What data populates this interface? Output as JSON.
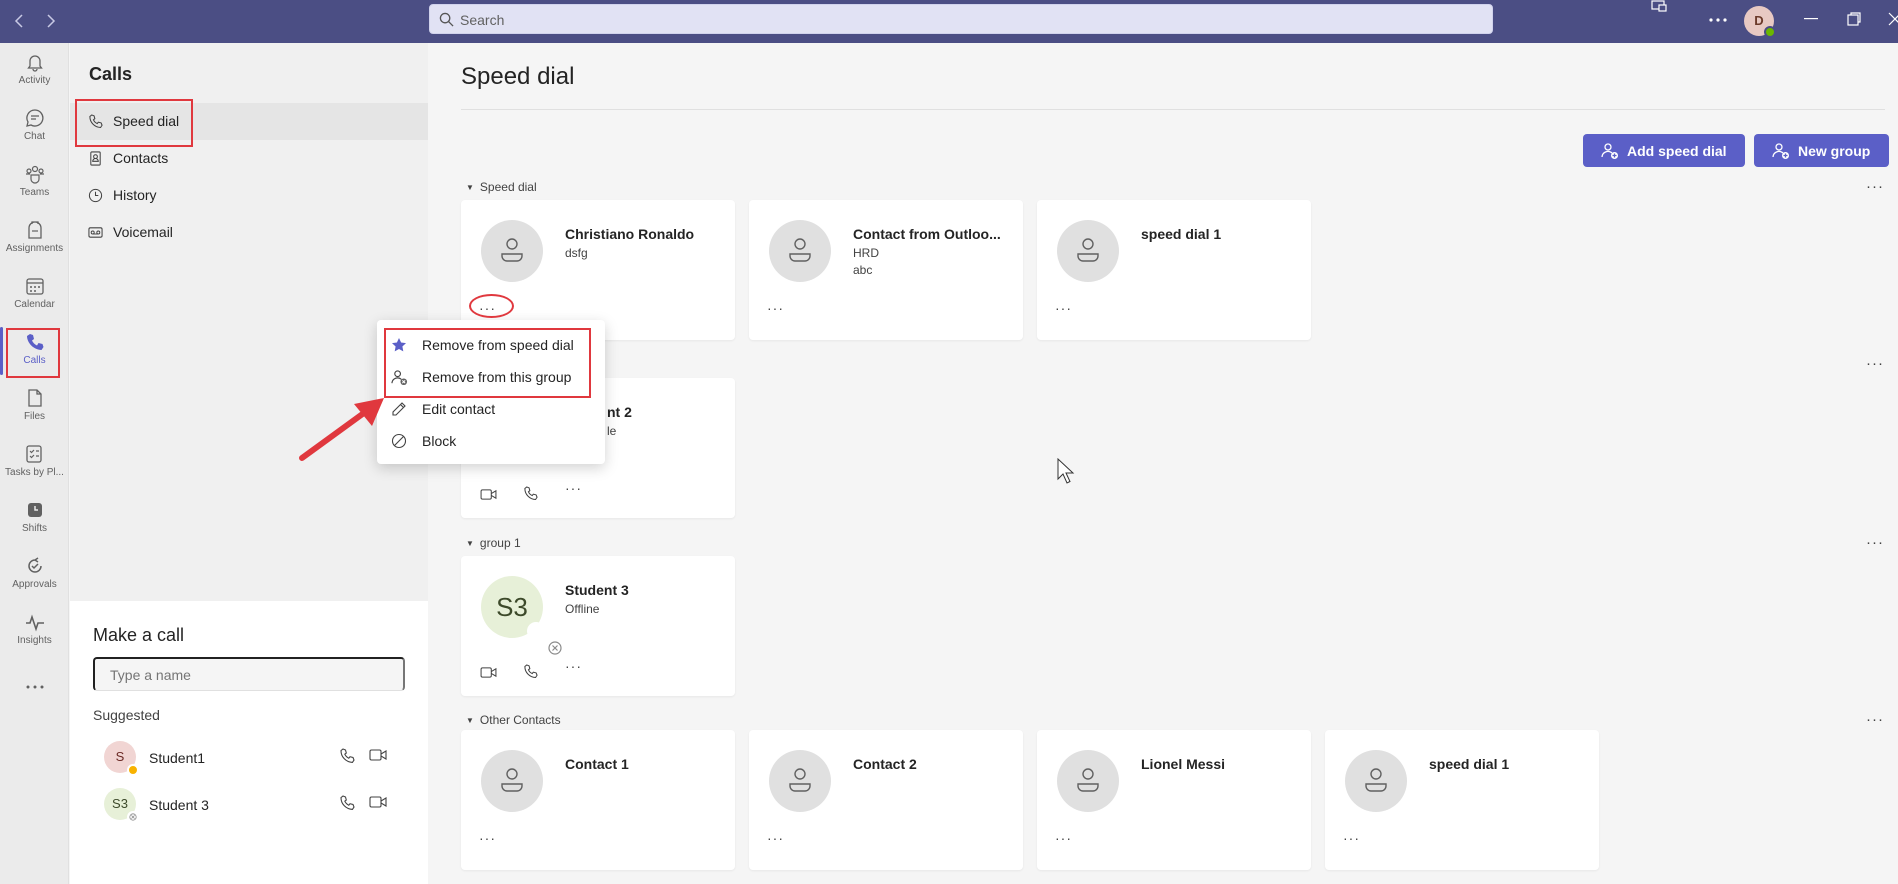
{
  "search": {
    "placeholder": "Search"
  },
  "user": {
    "initial": "D"
  },
  "rail": [
    {
      "label": "Activity",
      "icon": "bell-icon"
    },
    {
      "label": "Chat",
      "icon": "chat-icon"
    },
    {
      "label": "Teams",
      "icon": "teams-icon"
    },
    {
      "label": "Assignments",
      "icon": "assignments-icon"
    },
    {
      "label": "Calendar",
      "icon": "calendar-icon"
    },
    {
      "label": "Calls",
      "icon": "phone-icon"
    },
    {
      "label": "Files",
      "icon": "file-icon"
    },
    {
      "label": "Tasks by Pl...",
      "icon": "tasks-icon"
    },
    {
      "label": "Shifts",
      "icon": "shifts-icon"
    },
    {
      "label": "Approvals",
      "icon": "approvals-icon"
    },
    {
      "label": "Insights",
      "icon": "insights-icon"
    }
  ],
  "panel": {
    "title": "Calls",
    "nav": [
      {
        "label": "Speed dial",
        "icon": "phone-icon"
      },
      {
        "label": "Contacts",
        "icon": "contacts-icon"
      },
      {
        "label": "History",
        "icon": "clock-icon"
      },
      {
        "label": "Voicemail",
        "icon": "voicemail-icon"
      }
    ],
    "make_call": {
      "title": "Make a call",
      "placeholder": "Type a name",
      "suggested_label": "Suggested",
      "suggested": [
        {
          "initials": "S",
          "name": "Student1",
          "avatar_bg": "#f1d5d3",
          "presence": "#f8b200"
        },
        {
          "initials": "S3",
          "name": "Student 3",
          "avatar_bg": "#e7f0d8",
          "presence": "#ffffff"
        }
      ]
    }
  },
  "main": {
    "title": "Speed dial",
    "add_speed_dial": "Add speed dial",
    "new_group": "New group",
    "sections": [
      {
        "name": "Speed dial",
        "contacts": [
          {
            "name": "Christiano Ronaldo",
            "lines": [
              "dsfg"
            ]
          },
          {
            "name": "Contact from Outloo...",
            "lines": [
              "HRD",
              "abc"
            ]
          },
          {
            "name": "speed dial 1",
            "lines": []
          }
        ]
      },
      {
        "name": "",
        "contacts": [
          {
            "name": "nt 2",
            "lines": [
              "le"
            ]
          }
        ]
      },
      {
        "name": "group 1",
        "contacts": [
          {
            "name": "Student 3",
            "lines": [
              "Offline"
            ],
            "initials": "S3"
          }
        ]
      },
      {
        "name": "Other Contacts",
        "contacts": [
          {
            "name": "Contact 1",
            "lines": []
          },
          {
            "name": "Contact 2",
            "lines": []
          },
          {
            "name": "Lionel Messi",
            "lines": []
          },
          {
            "name": "speed dial 1",
            "lines": []
          }
        ]
      }
    ]
  },
  "context_menu": [
    {
      "label": "Remove from speed dial",
      "icon": "star-icon"
    },
    {
      "label": "Remove from this group",
      "icon": "person-remove-icon"
    },
    {
      "label": "Edit contact",
      "icon": "pencil-icon"
    },
    {
      "label": "Block",
      "icon": "block-icon"
    }
  ],
  "colors": {
    "accent": "#5b5fc7",
    "topbar": "#4b4e84",
    "highlight": "#e0383e"
  }
}
